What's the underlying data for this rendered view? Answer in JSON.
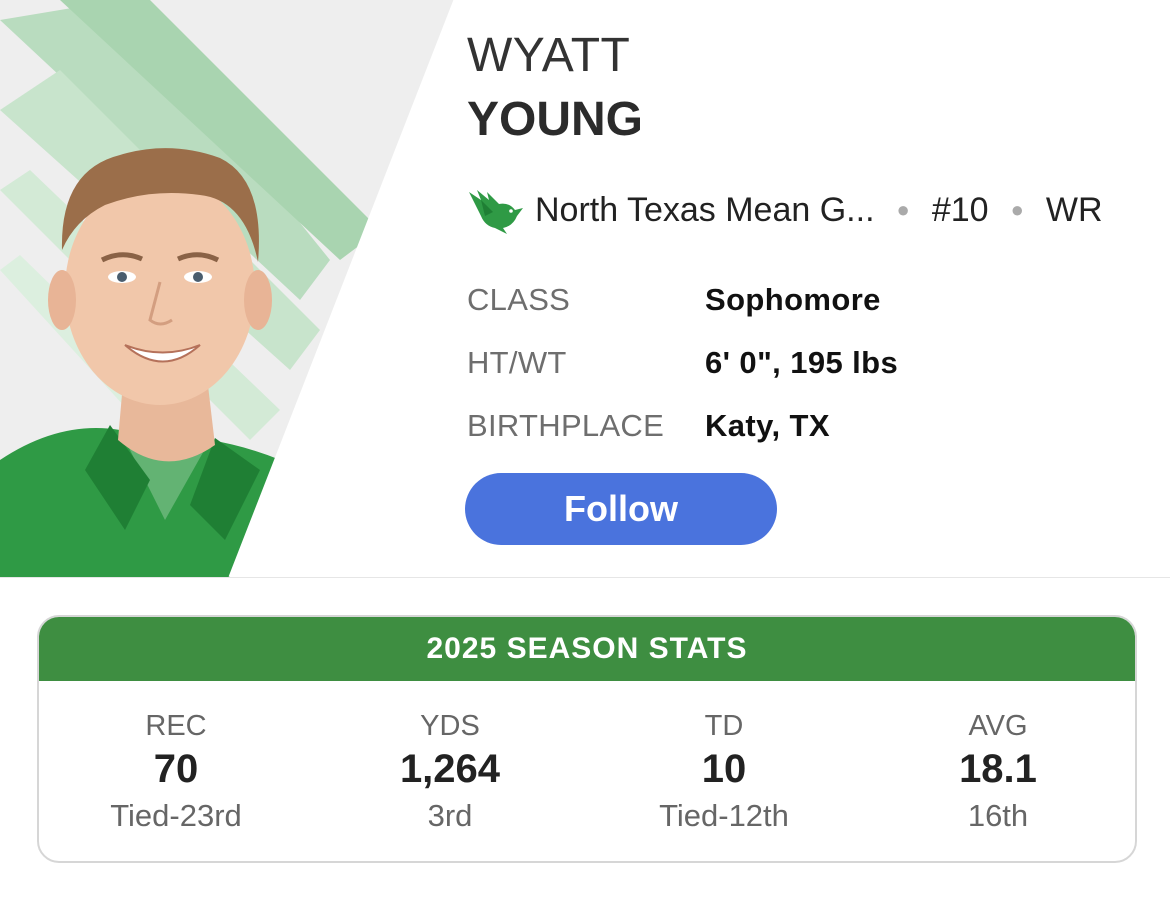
{
  "player": {
    "first_name": "WYATT",
    "last_name": "YOUNG",
    "team": "North Texas Mean G...",
    "number": "#10",
    "position": "WR",
    "team_color": "#3e8e41"
  },
  "info": [
    {
      "label": "CLASS",
      "value": "Sophomore"
    },
    {
      "label": "HT/WT",
      "value": "6' 0\", 195 lbs"
    },
    {
      "label": "BIRTHPLACE",
      "value": "Katy, TX"
    }
  ],
  "follow": {
    "label": "Follow",
    "color": "#4a73dd"
  },
  "stats": {
    "title": "2025 SEASON STATS",
    "items": [
      {
        "label": "REC",
        "value": "70",
        "rank": "Tied-23rd"
      },
      {
        "label": "YDS",
        "value": "1,264",
        "rank": "3rd"
      },
      {
        "label": "TD",
        "value": "10",
        "rank": "Tied-12th"
      },
      {
        "label": "AVG",
        "value": "18.1",
        "rank": "16th"
      }
    ]
  },
  "icons": {
    "team_logo": "eagle-logo-icon",
    "separator": "dot-separator-icon"
  }
}
